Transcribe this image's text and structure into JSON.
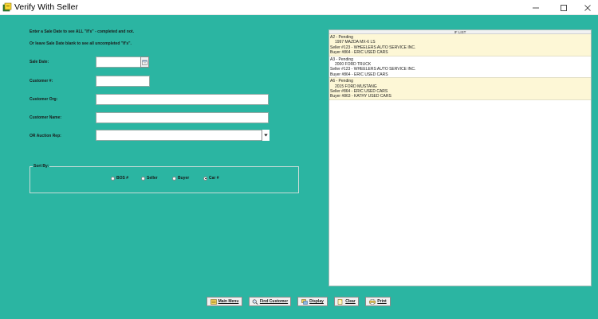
{
  "window": {
    "title": "Verify With Seller"
  },
  "instructions": {
    "line1": "Enter a Sale Date to see ALL \"If's\" - completed and not.",
    "line2": "Or leave Sale Date blank to see all uncompleted \"If's\"."
  },
  "form": {
    "sale_date_label": "Sale Date:",
    "customer_num_label": "Customer #:",
    "customer_org_label": "Customer Org:",
    "customer_name_label": "Customer Name:",
    "auction_rep_label": "OR Auction Rep:",
    "sale_date_value": "",
    "customer_num_value": "",
    "customer_org_value": "",
    "customer_name_value": "",
    "auction_rep_value": ""
  },
  "sort": {
    "legend": "Sort By:",
    "options": [
      "BOS #",
      "Seller",
      "Buyer",
      "Car #"
    ],
    "selected": "Car #"
  },
  "if_list": {
    "header": "IF LIST",
    "entries": [
      {
        "status": "A2 - Pending",
        "car": "1997 MAZDA MX-6 LS",
        "seller": "Seller #123 - WHEELERS AUTO SERVICE INC.",
        "buyer": "Buyer #864 - ERIC USED CARS"
      },
      {
        "status": "A3 - Pending",
        "car": "2000 FORD TRUCK",
        "seller": "Seller #123 - WHEELERS AUTO SERVICE INC.",
        "buyer": "Buyer #864 - ERIC USED CARS"
      },
      {
        "status": "A6 - Pending",
        "car": "2015 FORD MUSTANG",
        "seller": "Seller #864 - ERIC USED CARS",
        "buyer": "Buyer #863 - KATHY USED CARS"
      }
    ]
  },
  "buttons": {
    "main_menu": "Main Menu",
    "find_customer": "Find Customer",
    "display": "Display",
    "clear": "Clear",
    "print": "Print"
  },
  "colors": {
    "background": "#2bb5a2",
    "list_highlight": "#fdf7d6"
  }
}
